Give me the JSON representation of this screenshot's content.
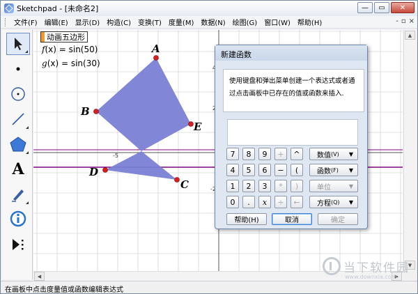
{
  "window": {
    "title": "Sketchpad - [未命名2]",
    "buttons": [
      "—",
      "▭",
      "✕"
    ]
  },
  "menubar": {
    "items": [
      "文件(F)",
      "编辑(E)",
      "显示(D)",
      "构造(C)",
      "变换(T)",
      "度量(M)",
      "数据(N)",
      "绘图(G)",
      "窗口(W)",
      "帮助(H)"
    ],
    "right_controls": [
      "-",
      "▫",
      "×"
    ]
  },
  "toolbar": {
    "tools": [
      "arrow-select",
      "point",
      "compass",
      "straightedge",
      "polygon",
      "text",
      "marker",
      "information",
      "custom-tools"
    ]
  },
  "canvas": {
    "animation_button": "动画五边形",
    "f_name": "f",
    "f_expr": "(x) = sin(50)",
    "g_name": "g",
    "g_expr": "(x) = sin(30)",
    "axis_ticks": {
      "x_minus5": "-5",
      "y_4": "4",
      "y_2": "2",
      "y_minus2": "-2"
    },
    "points": {
      "A": "A",
      "B": "B",
      "C": "C",
      "D": "D",
      "E": "E"
    }
  },
  "dialog": {
    "title": "新建函数",
    "message_line1": "使用键盘和弹出菜单创建一个表达式或者通",
    "message_line2": "过点击画板中已存在的值或函数来插入.",
    "keys": {
      "row1": [
        "7",
        "8",
        "9",
        "+",
        "^"
      ],
      "row2": [
        "4",
        "5",
        "6",
        "−",
        "("
      ],
      "row3": [
        "1",
        "2",
        "3",
        "*",
        ")"
      ],
      "row4": [
        "0",
        ".",
        "x",
        "÷",
        "←"
      ]
    },
    "menus": {
      "values": "数值",
      "functions": "函数",
      "units": "单位",
      "equation": "方程"
    },
    "menu_hotkeys": {
      "values": "(V)",
      "functions": "(F)",
      "equation": "(Q)"
    },
    "buttons": {
      "help": "帮助(H)",
      "cancel": "取消",
      "ok": "确定"
    }
  },
  "statusbar": {
    "text": "在画板中点击度量值或函数编辑表达式"
  },
  "watermark": {
    "brand": "当下软件园",
    "url": "www.downxia.com"
  },
  "colors": {
    "polygon_fill": "#7b7fd4",
    "point": "#d81e1e",
    "line": "#800080",
    "grid": "#c8c8c8",
    "accent": "#f39a2c"
  }
}
